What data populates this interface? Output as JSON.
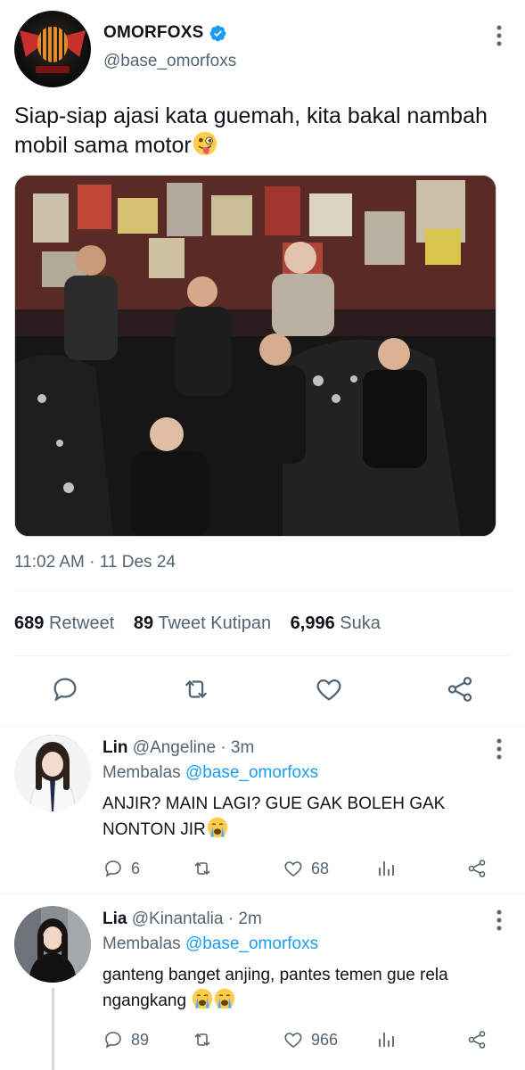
{
  "tweet": {
    "display_name": "OMORFOXS",
    "handle": "@base_omorfoxs",
    "text": "Siap-siap ajasi kata guemah, kita bakal nambah mobil sama motor",
    "emoji": "winking-face-with-tongue",
    "timestamp": "11:02 AM · 11 Des 24",
    "stats": {
      "retweets": "689",
      "retweets_label": "Retweet",
      "quotes": "89",
      "quotes_label": "Tweet Kutipan",
      "likes": "6,996",
      "likes_label": "Suka"
    },
    "actions": [
      "reply-icon",
      "retweet-icon",
      "like-icon",
      "share-icon"
    ]
  },
  "replies": [
    {
      "name": "Lin",
      "handle": "@Angeline",
      "time": "· 3m",
      "replying_label": "Membalas",
      "replying_to": "@base_omorfoxs",
      "text": "ANJIR? MAIN LAGI? GUE GAK BOLEH GAK NONTON JIR",
      "emoji": "loudly-crying-face",
      "reply_count": "6",
      "retweet_count": "",
      "like_count": "68"
    },
    {
      "name": "Lia",
      "handle": "@Kinantalia",
      "time": "· 2m",
      "replying_label": "Membalas",
      "replying_to": "@base_omorfoxs",
      "text": "ganteng banget anjing, pantes temen gue rela ngangkang",
      "emoji": "loudly-crying-face",
      "reply_count": "89",
      "retweet_count": "",
      "like_count": "966"
    }
  ],
  "colors": {
    "text": "#0f1419",
    "secondary": "#536471",
    "accent": "#1d9bf0",
    "divider": "#eff3f4"
  }
}
